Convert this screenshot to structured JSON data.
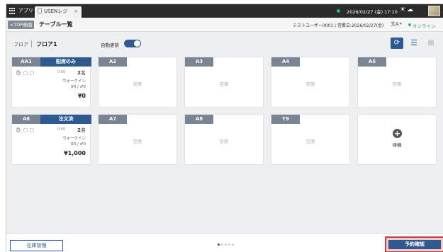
{
  "topbar": {
    "app_label": "アプリ",
    "tab_title": "USENレジ",
    "tab_close": "×",
    "datetime": "2026/02/27 (金) 17:10",
    "sun_icon": "☀",
    "cloud_icon": "☁"
  },
  "header": {
    "back_label": "<TOP画面",
    "title": "テーブル一覧",
    "user_info": "テストユーザー0001 | 営業日:2026/02/27(金)",
    "lang_icon": "文A",
    "lang_caret": "▾",
    "online": "オンライン"
  },
  "floor": {
    "label": "フロア",
    "name": "フロア1",
    "auto_update": "自動更新"
  },
  "tools": {
    "refresh": "⟳",
    "list": "☰",
    "tiles": "▦"
  },
  "cards": [
    {
      "code": "AA1",
      "state": "配席のみ",
      "timer": "0:00",
      "guests": "2",
      "guest_unit": "名",
      "type": "ウォークイン",
      "counts": "♀0 / ♂0",
      "amount": "¥0"
    },
    {
      "code": "A2",
      "empty": "空席"
    },
    {
      "code": "A3",
      "empty": "空席"
    },
    {
      "code": "A4",
      "empty": "空席"
    },
    {
      "code": "A5",
      "empty": "空席"
    },
    {
      "code": "A6",
      "state": "注文済",
      "timer": "0:00",
      "guests": "2",
      "guest_unit": "名",
      "type": "ウォークイン",
      "counts": "♀0 / ♂0",
      "amount": "¥1,000"
    },
    {
      "code": "A7",
      "empty": "空席"
    },
    {
      "code": "A8",
      "empty": "空席"
    },
    {
      "code": "T9",
      "empty": "空席"
    },
    {
      "wait_label": "待機",
      "plus": "+"
    }
  ],
  "bottom": {
    "stock_label": "在庫管理",
    "reserve_label": "予約確認"
  }
}
